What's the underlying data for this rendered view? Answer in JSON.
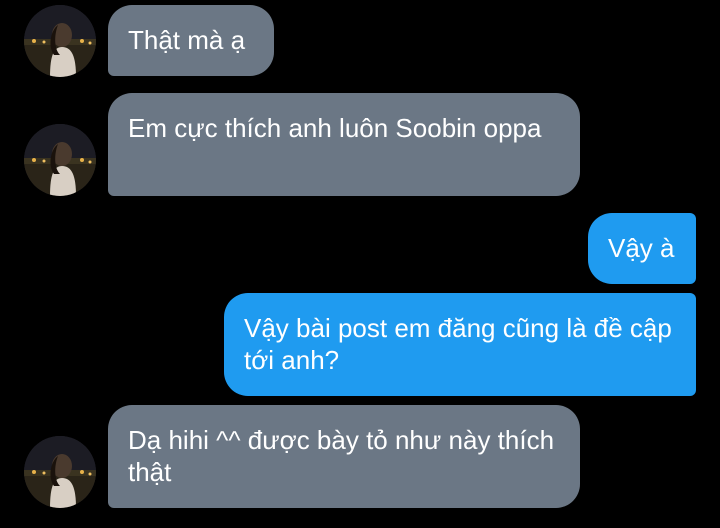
{
  "conversation": {
    "messages": [
      {
        "direction": "incoming",
        "text": "Thật mà ạ"
      },
      {
        "direction": "incoming",
        "text": "Em cực thích anh luôn Soobin oppa"
      },
      {
        "direction": "outgoing",
        "text": "Vậy à"
      },
      {
        "direction": "outgoing",
        "text": "Vậy bài post em đăng cũng là đề cập tới anh?"
      },
      {
        "direction": "incoming",
        "text": "Dạ hihi ^^ được bày tỏ như này thích thật"
      }
    ]
  },
  "colors": {
    "background": "#000000",
    "incoming_bubble": "#6b7785",
    "outgoing_bubble": "#1f9bf0",
    "text": "#ffffff"
  },
  "icons": {
    "avatar": "contact-avatar-photo"
  }
}
